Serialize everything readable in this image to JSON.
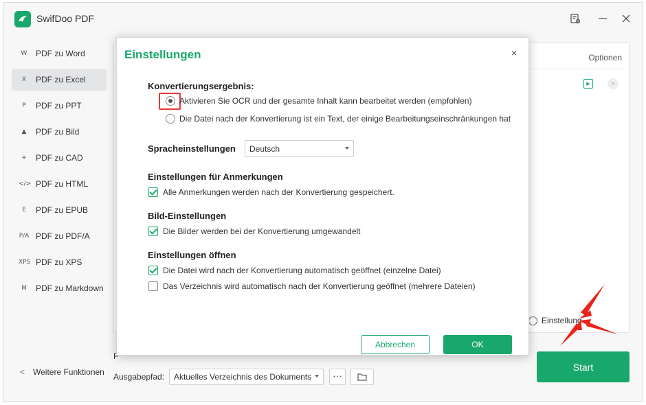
{
  "app": {
    "title": "SwifDoo PDF"
  },
  "sidebar": {
    "items": [
      {
        "icon": "W",
        "label": "PDF zu Word"
      },
      {
        "icon": "X",
        "label": "PDF zu Excel"
      },
      {
        "icon": "P",
        "label": "PDF zu PPT"
      },
      {
        "icon": "▲",
        "label": "PDF zu Bild"
      },
      {
        "icon": "+",
        "label": "PDF zu CAD"
      },
      {
        "icon": "</>",
        "label": "PDF zu HTML"
      },
      {
        "icon": "E",
        "label": "PDF zu EPUB"
      },
      {
        "icon": "P/A",
        "label": "PDF zu PDF/A"
      },
      {
        "icon": "XPS",
        "label": "PDF zu XPS"
      },
      {
        "icon": "M",
        "label": "PDF zu Markdown"
      }
    ],
    "more": "Weitere Funktionen"
  },
  "content": {
    "options_label": "Optionen",
    "einstellung_label": "Einstellung",
    "output_f": "F",
    "output_label": "Ausgabepfad:",
    "output_value": "Aktuelles Verzeichnis des Dokuments",
    "dots": "···",
    "start_label": "Start"
  },
  "dialog": {
    "title": "Einstellungen",
    "close": "×",
    "conversion": {
      "heading": "Konvertierungsergebnis:",
      "opt1": "Aktivieren Sie OCR und der gesamte Inhalt kann bearbeitet werden (empfohlen)",
      "opt2": "Die Datei nach der Konvertierung ist ein Text, der einige Bearbeitungseinschränkungen hat"
    },
    "language": {
      "label": "Spracheinstellungen",
      "value": "Deutsch"
    },
    "annotations": {
      "heading": "Einstellungen für Anmerkungen",
      "opt": "Alle Anmerkungen werden nach der Konvertierung gespeichert."
    },
    "images": {
      "heading": "Bild-Einstellungen",
      "opt": "Die Bilder werden bei der Konvertierung umgewandelt"
    },
    "open": {
      "heading": "Einstellungen öffnen",
      "opt1": "Die Datei wird nach der Konvertierung automatisch geöffnet (einzelne Datei)",
      "opt2": "Das Verzeichnis wird automatisch nach der Konvertierung geöffnet (mehrere Dateien)"
    },
    "cancel_label": "Abbrechen",
    "ok_label": "OK"
  },
  "colors": {
    "accent": "#19a86b",
    "highlight": "#e53935"
  }
}
